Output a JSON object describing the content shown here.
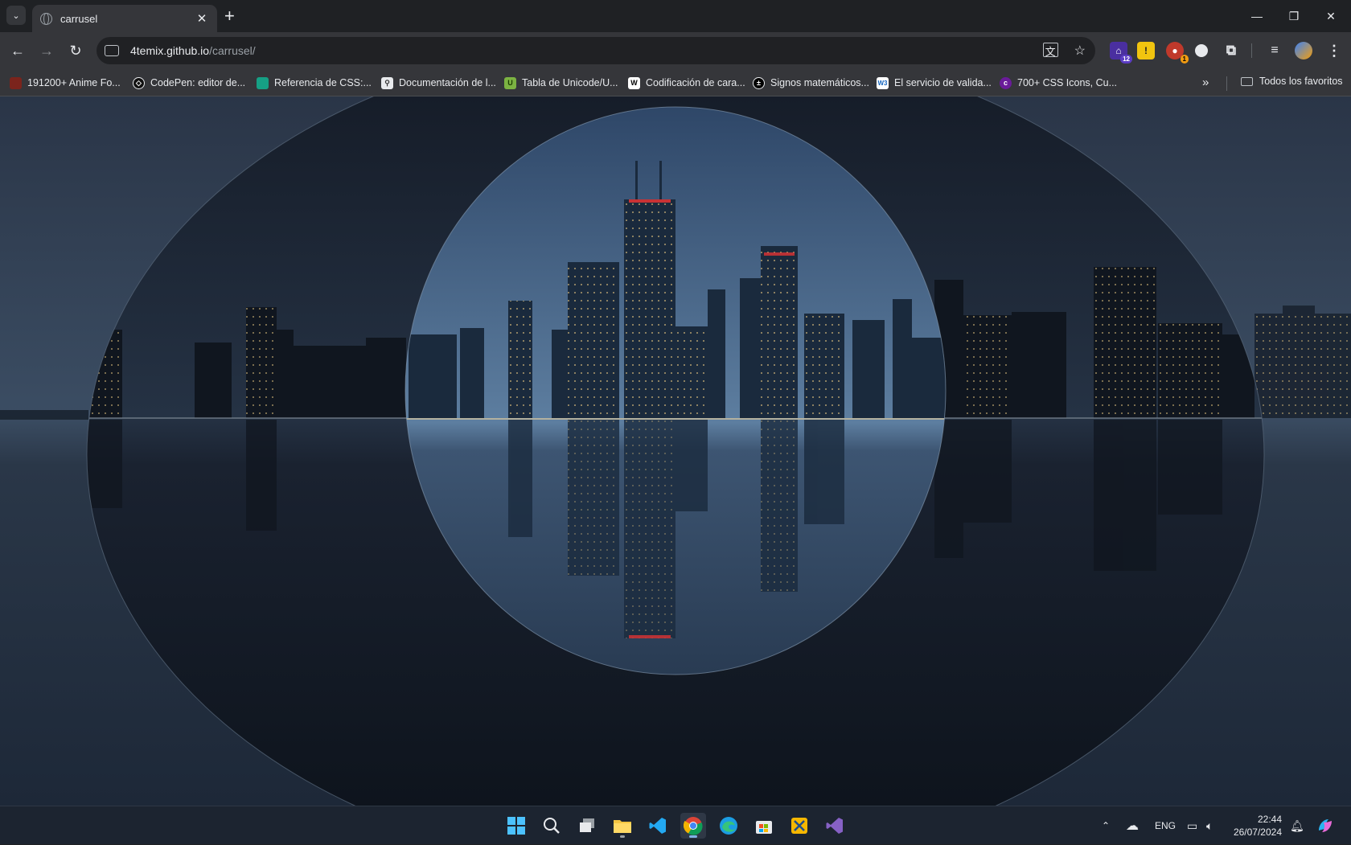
{
  "tab": {
    "title": "carrusel"
  },
  "address_bar": {
    "host": "4temix.github.io",
    "path": "/carrusel/"
  },
  "extensions": {
    "ext1_badge": "12",
    "ext3_badge": "1"
  },
  "bookmarks": [
    {
      "label": "191200+ Anime Fo...",
      "icon": "anime-icon",
      "color": "#c0392b"
    },
    {
      "label": "CodePen: editor de...",
      "icon": "codepen-icon",
      "color": "#111111"
    },
    {
      "label": "Referencia de CSS:...",
      "icon": "mdn-icon",
      "color": "#1abc9c"
    },
    {
      "label": "Documentación de l...",
      "icon": "search-doc-icon",
      "color": "#e8eaed"
    },
    {
      "label": "Tabla de Unicode/U...",
      "icon": "unicode-icon",
      "color": "#8bc34a"
    },
    {
      "label": "Codificación de cara...",
      "icon": "wikipedia-icon",
      "color": "#ffffff"
    },
    {
      "label": "Signos matemáticos...",
      "icon": "math-icon",
      "color": "#000000"
    },
    {
      "label": "El servicio de valida...",
      "icon": "w3c-icon",
      "color": "#1565c0"
    },
    {
      "label": "700+ CSS Icons, Cu...",
      "icon": "css-gg-icon",
      "color": "#6a1b9a"
    }
  ],
  "bookmarks_more_icon": "chevron-double-right-icon",
  "all_bookmarks": {
    "label": "Todos los favoritos"
  },
  "taskbar": {
    "apps": [
      "windows-start-icon",
      "search-icon",
      "task-view-icon",
      "file-explorer-icon",
      "vscode-icon",
      "chrome-icon",
      "edge-icon",
      "store-icon",
      "snipping-icon",
      "visual-studio-icon"
    ],
    "active_app": "chrome-icon",
    "language": "ENG",
    "time": "22:44",
    "date": "26/07/2024"
  },
  "colors": {
    "chrome_dark": "#35363a",
    "tab_strip": "#1f2124",
    "accent_blue": "#7fb2e5"
  }
}
